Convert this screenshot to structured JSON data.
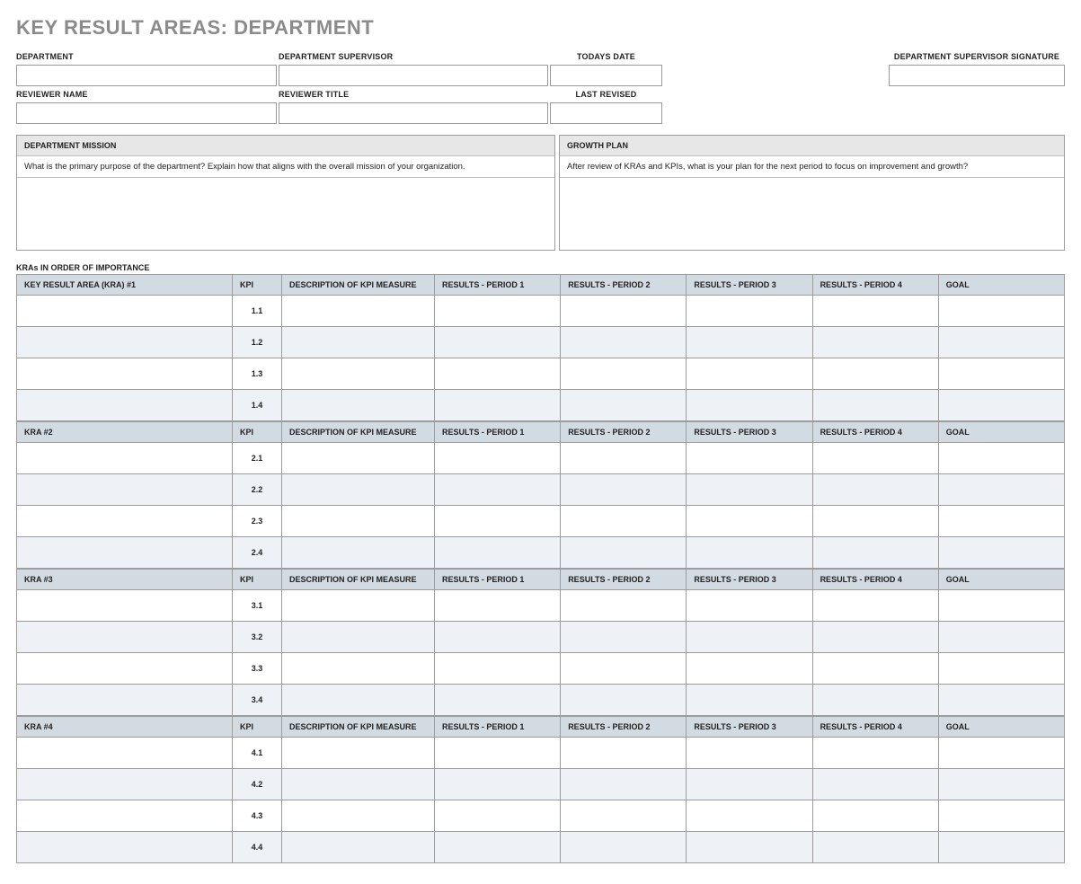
{
  "title": "KEY RESULT AREAS: DEPARTMENT",
  "top": {
    "department_label": "DEPARTMENT",
    "supervisor_label": "DEPARTMENT SUPERVISOR",
    "todays_date_label": "TODAYS DATE",
    "signature_label": "DEPARTMENT SUPERVISOR SIGNATURE",
    "reviewer_name_label": "REVIEWER NAME",
    "reviewer_title_label": "REVIEWER TITLE",
    "last_revised_label": "LAST REVISED"
  },
  "mission": {
    "header": "DEPARTMENT MISSION",
    "sub": "What is the primary purpose of the department?  Explain how that aligns with the overall mission of your organization."
  },
  "growth": {
    "header": "GROWTH PLAN",
    "sub": "After review of KRAs and KPIs, what is your plan for the next period to focus on improvement and growth?"
  },
  "kra_section_label": "KRAs IN ORDER OF IMPORTANCE",
  "columns": {
    "kpi": "KPI",
    "desc": "DESCRIPTION OF KPI MEASURE",
    "p1": "RESULTS - PERIOD 1",
    "p2": "RESULTS - PERIOD 2",
    "p3": "RESULTS - PERIOD 3",
    "p4": "RESULTS - PERIOD 4",
    "goal": "GOAL"
  },
  "kras": [
    {
      "label": "KEY RESULT AREA (KRA) #1",
      "rows": [
        "1.1",
        "1.2",
        "1.3",
        "1.4"
      ]
    },
    {
      "label": "KRA #2",
      "rows": [
        "2.1",
        "2.2",
        "2.3",
        "2.4"
      ]
    },
    {
      "label": "KRA #3",
      "rows": [
        "3.1",
        "3.2",
        "3.3",
        "3.4"
      ]
    },
    {
      "label": "KRA #4",
      "rows": [
        "4.1",
        "4.2",
        "4.3",
        "4.4"
      ]
    }
  ]
}
